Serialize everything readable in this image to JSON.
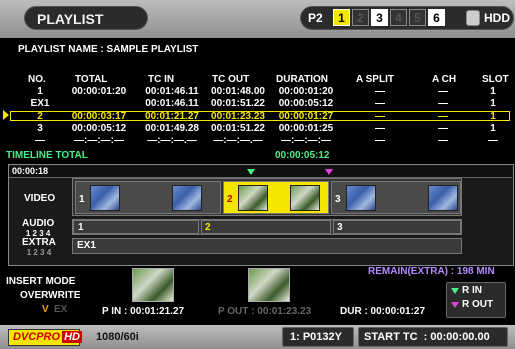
{
  "header": {
    "title": "PLAYLIST",
    "p2_label": "P2",
    "slots": [
      "1",
      "2",
      "3",
      "4",
      "5",
      "6"
    ],
    "hdd_label": "HDD"
  },
  "playlist": {
    "name_label": "PLAYLIST NAME : SAMPLE PLAYLIST",
    "columns": [
      "NO.",
      "TOTAL",
      "TC IN",
      "TC OUT",
      "DURATION",
      "A SPLIT",
      "A CH",
      "SLOT"
    ],
    "rows": [
      {
        "no": "1",
        "total": "00:00:01:20",
        "tc_in": "00:01:46.11",
        "tc_out": "00:01:48.00",
        "duration": "00:00:01:20",
        "a_split": "—",
        "a_ch": "—",
        "slot": "1"
      },
      {
        "no": "EX1",
        "total": "",
        "tc_in": "00:01:46.11",
        "tc_out": "00:01:51.22",
        "duration": "00:00:05:12",
        "a_split": "—",
        "a_ch": "—",
        "slot": "1"
      },
      {
        "no": "2",
        "total": "00:00:03:17",
        "tc_in": "00:01:21.27",
        "tc_out": "00:01:23.23",
        "duration": "00:00:01:27",
        "a_split": "—",
        "a_ch": "—",
        "slot": "1"
      },
      {
        "no": "3",
        "total": "00:00:05:12",
        "tc_in": "00:01:49.28",
        "tc_out": "00:01:51.22",
        "duration": "00:00:01:25",
        "a_split": "—",
        "a_ch": "—",
        "slot": "1"
      },
      {
        "no": "—",
        "total": "—:—:—:—",
        "tc_in": "—:—:—.—",
        "tc_out": "—:—:—.—",
        "duration": "—:—:—:—",
        "a_split": "—",
        "a_ch": "—",
        "slot": "—"
      }
    ],
    "timeline_total_label": "TIMELINE TOTAL",
    "timeline_total_value": "00:00:05:12"
  },
  "timeline": {
    "ruler_time": "00:00:18",
    "video_label": "VIDEO",
    "audio_label": "AUDIO",
    "audio_channels": "1 2 3 4",
    "extra_label": "EXTRA",
    "extra_channels": "1 2 3 4",
    "clips": [
      "1",
      "2",
      "3"
    ],
    "audio_nums": [
      "1",
      "2",
      "3"
    ],
    "extra_clip": "EX1"
  },
  "bottom": {
    "insert_mode_label": "INSERT MODE",
    "overwrite_label": "OVERWRITE",
    "v_label": "V",
    "ex_label": "EX",
    "p_in": "P IN : 00:01:21.27",
    "p_out": "P OUT : 00:01:23.23",
    "dur": "DUR : 00:00:01:27",
    "remain": "REMAIN(EXTRA) : 198 MIN",
    "r_in": "R IN",
    "r_out": "R OUT"
  },
  "footer": {
    "codec": "DVCPRO",
    "codec_hd": "HD",
    "format": "1080/60i",
    "clip_id": "1: P0132Y",
    "start_tc": "START TC  : 00:00:00.00"
  },
  "colors": {
    "accent": "#f5e600",
    "green": "#4cf08a",
    "magenta": "#e040e0"
  }
}
